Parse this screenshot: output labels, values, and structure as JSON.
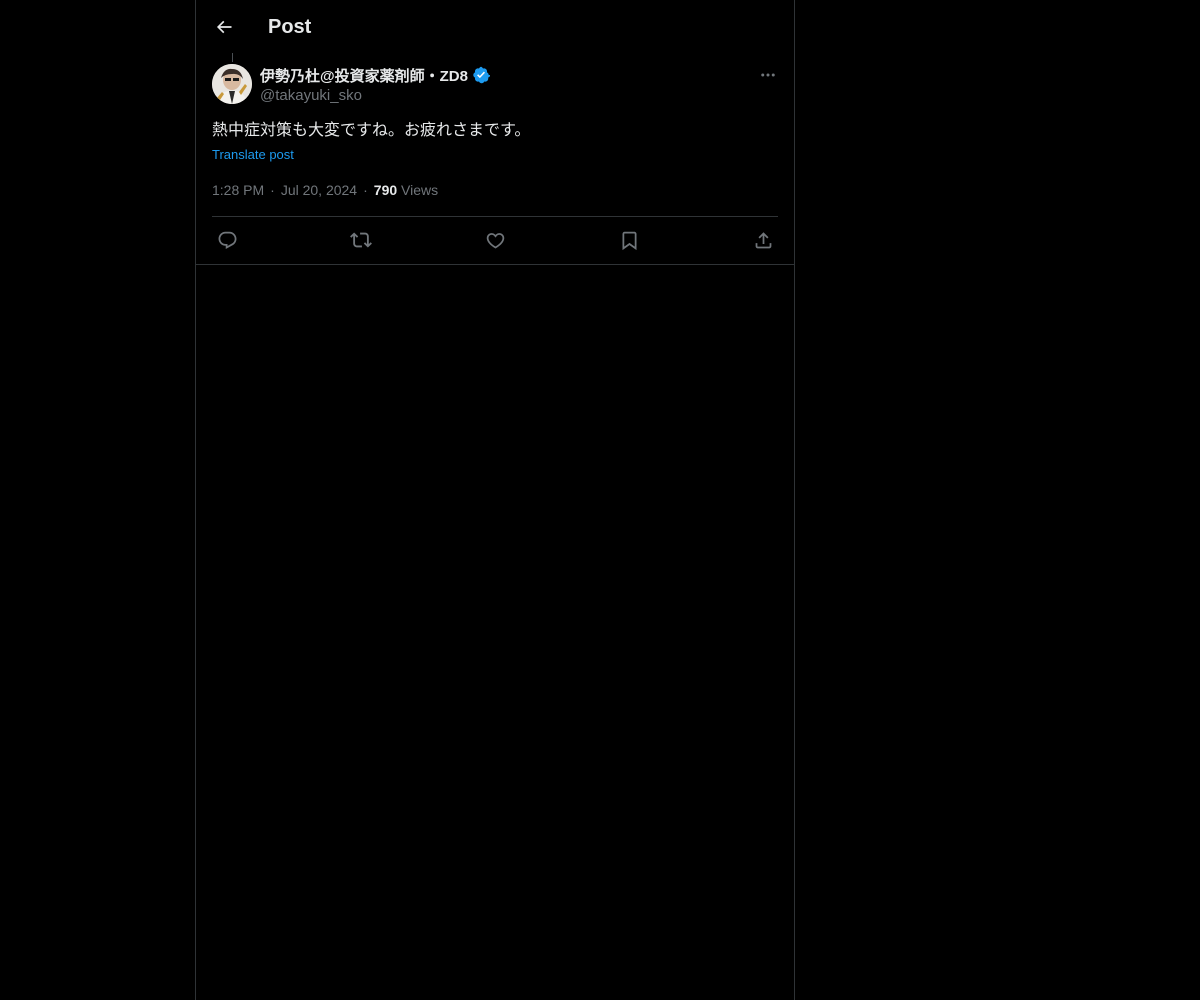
{
  "header": {
    "title": "Post",
    "back_icon": "arrow-left-icon"
  },
  "post": {
    "author_name": "伊勢乃杜@投資家薬剤師・ZD8",
    "author_handle": "@takayuki_sko",
    "verified": true,
    "text": "熱中症対策も大変ですね。お疲れさまです。",
    "translate_label": "Translate post",
    "time": "1:28 PM",
    "date": "Jul 20, 2024",
    "views_count": "790",
    "views_label": "Views"
  },
  "actions": {
    "icons": [
      "reply-icon",
      "repost-icon",
      "like-icon",
      "bookmark-icon",
      "share-icon"
    ]
  },
  "colors": {
    "background": "#000000",
    "text_primary": "#e7e9ea",
    "text_secondary": "#71767b",
    "accent": "#1d9bf0",
    "border": "#2f3336"
  }
}
